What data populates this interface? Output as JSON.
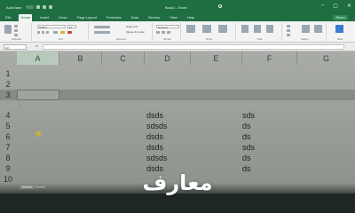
{
  "titlebar": {
    "autosave": "AutoSave",
    "doc_title": "Book1 - Excel",
    "window_buttons": [
      "–",
      "▢",
      "✕"
    ]
  },
  "tabs": [
    "File",
    "Home",
    "Insert",
    "Draw",
    "Page Layout",
    "Formulas",
    "Data",
    "Review",
    "View",
    "Help"
  ],
  "active_tab": "Home",
  "share_label": "Share",
  "ribbon": {
    "font_name": "Calibri",
    "font_size": "11",
    "number_format": "General",
    "wrap_text": "Wrap Text",
    "merge_center": "Merge & Center",
    "groups": [
      "Clipboard",
      "Font",
      "Alignment",
      "Number",
      "Styles",
      "Cells",
      "Editing",
      "Ideas"
    ]
  },
  "namebox": "A3",
  "formula_label": "fx",
  "columns": [
    "A",
    "B",
    "C",
    "D",
    "E",
    "F",
    "G"
  ],
  "selected_column": "A",
  "rows": [
    "1",
    "2",
    "3",
    "4",
    "5",
    "6",
    "7",
    "8",
    "9",
    "10"
  ],
  "selected_row": "3",
  "cells": {
    "D4": "dsds",
    "F4": "sds",
    "D5": "sdsds",
    "F5": "ds",
    "D6": "dsds",
    "F6": "ds",
    "D7": "dsds",
    "F7": "sds",
    "D8": "sdsds",
    "F8": "ds",
    "D9": "dsds",
    "F9": "ds"
  },
  "sheet_tabs": [
    "Sheet1",
    "Sheet2"
  ],
  "watermark": "معارف"
}
